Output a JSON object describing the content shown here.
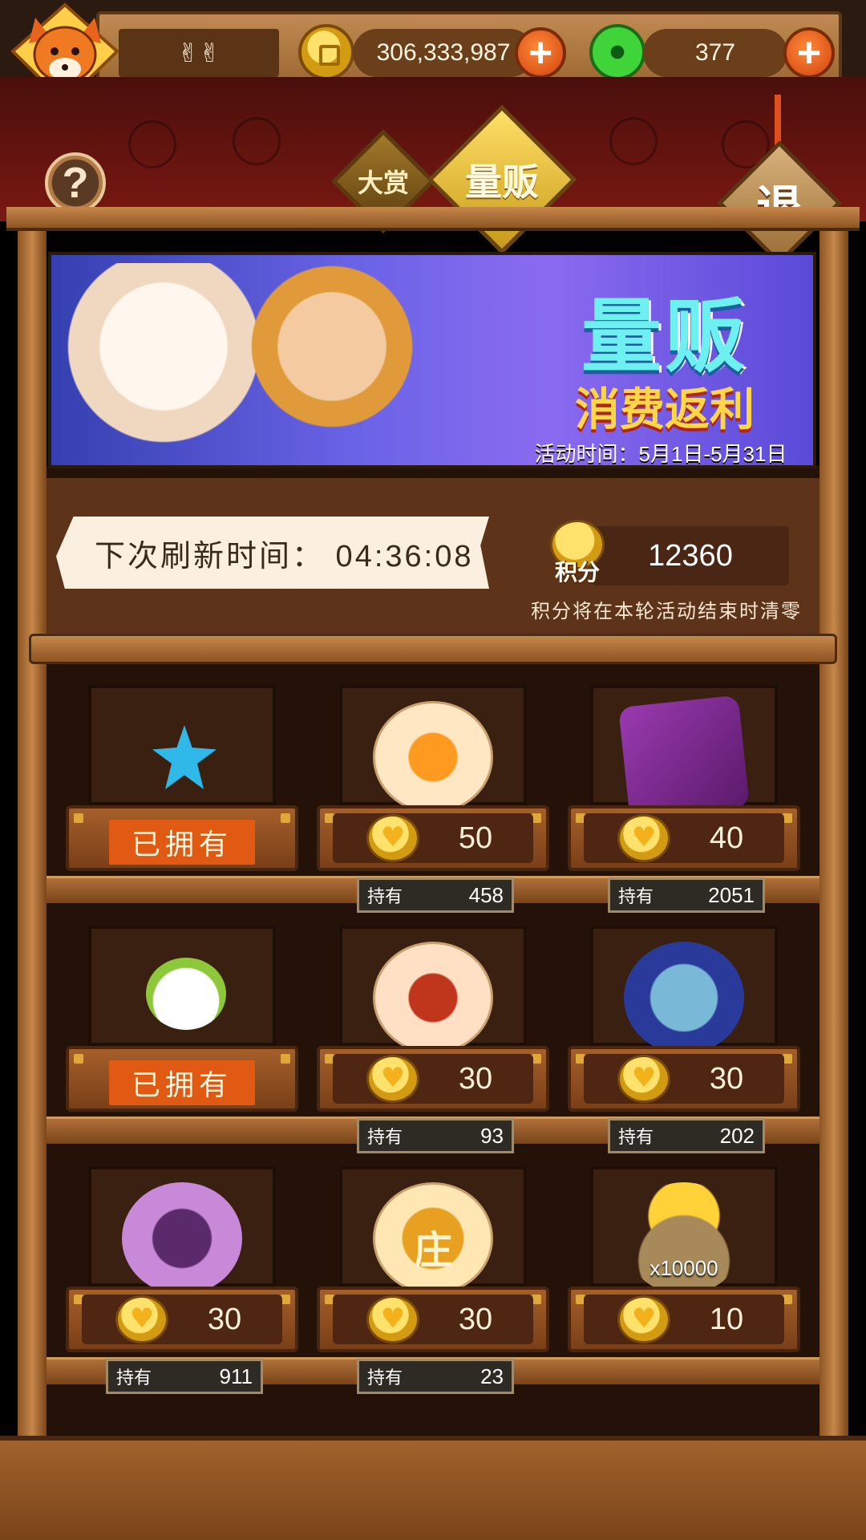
{
  "topbar": {
    "player_name": "✌✌",
    "coins": "306,333,987",
    "gems": "377",
    "plus_label": "+"
  },
  "tabs": {
    "dashang": "大赏",
    "liangfan": "量贩",
    "exit": "退",
    "help": "?"
  },
  "banner": {
    "title": "量贩",
    "subtitle": "消费返利",
    "date": "活动时间：5月1日-5月31日"
  },
  "info": {
    "refresh_text": "下次刷新时间：  04:36:08",
    "points_label": "积分",
    "points_value": "12360",
    "points_note": "积分将在本轮活动结束时清零"
  },
  "items": [
    {
      "name": "star-gem",
      "owned": true,
      "owned_label": "已拥有",
      "price": "",
      "stock_label": "",
      "stock": ""
    },
    {
      "name": "fire-rune",
      "owned": false,
      "price": "50",
      "stock_label": "持有",
      "stock": "458"
    },
    {
      "name": "purple-dice",
      "owned": false,
      "price": "40",
      "stock_label": "持有",
      "stock": "2051"
    },
    {
      "name": "leaf-cat",
      "owned": true,
      "owned_label": "已拥有",
      "price": "",
      "stock_label": "",
      "stock": ""
    },
    {
      "name": "demon-rune",
      "owned": false,
      "price": "30",
      "stock_label": "持有",
      "stock": "93"
    },
    {
      "name": "blue-cube",
      "owned": false,
      "price": "30",
      "stock_label": "持有",
      "stock": "202"
    },
    {
      "name": "mask-orb",
      "owned": false,
      "price": "30",
      "stock_label": "持有",
      "stock": "911"
    },
    {
      "name": "zhuang-badge",
      "owned": false,
      "price": "30",
      "stock_label": "持有",
      "stock": "23",
      "art_text": "庄"
    },
    {
      "name": "coin-bag",
      "owned": false,
      "price": "10",
      "stock_label": "",
      "stock": "",
      "art_text": "x10000"
    }
  ],
  "colors": {
    "owned_badge": "#e05a14",
    "accent_gold": "#ffd64a",
    "banner_title": "#6ef0f0"
  }
}
